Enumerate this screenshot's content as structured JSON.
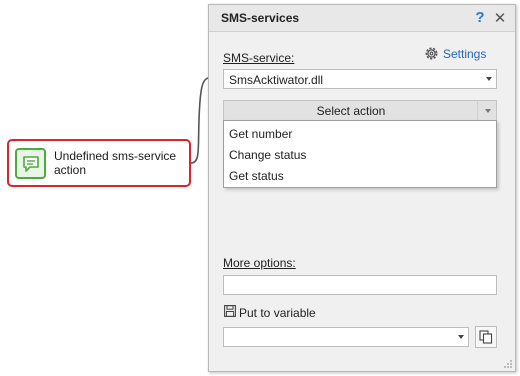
{
  "node": {
    "label": "Undefined sms-service action",
    "icon": "chat-bubble-icon",
    "border_color": "#d9262c",
    "icon_color": "#4daa3c"
  },
  "panel": {
    "title": "SMS-services",
    "help_label": "?",
    "close_label": "✕",
    "service_label": "SMS-service:",
    "settings_label": "Settings",
    "service_value": "SmsAcktiwator.dll",
    "action_label": "Select action",
    "actions": [
      "Get number",
      "Change status",
      "Get status"
    ],
    "more_options_label": "More options:",
    "more_options_value": "",
    "put_to_variable_label": "Put to variable",
    "variable_value": "",
    "link_color": "#2563b7",
    "help_color": "#2b78c4"
  }
}
